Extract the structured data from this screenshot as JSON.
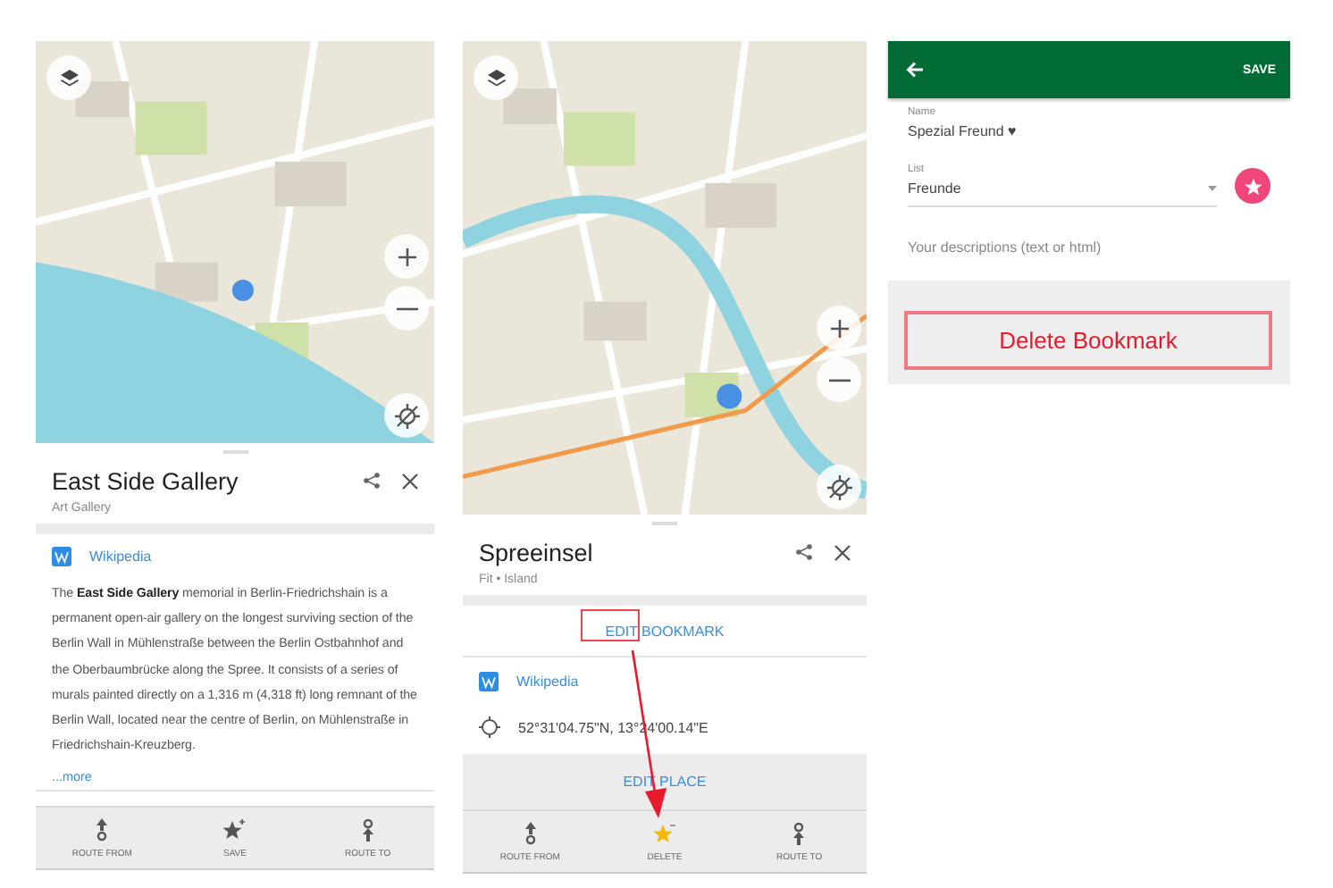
{
  "place_view": {
    "title": "East Side Gallery",
    "subtitle": "Art Gallery",
    "wikipedia_link": "Wikipedia",
    "description": "The **East Side Gallery** memorial in Berlin-Friedrichshain is a permanent open-air gallery on the longest surviving section of the Berlin Wall in Mühlenstraße between the Berlin Ostbahnhof and the Oberbaumbrücke along the Spree. It consists of a series of murals painted directly on a 1,316 m (4,318 ft) long remnant of the Berlin Wall, located near the centre of Berlin, on Mühlenstraße in Friedrichshain-Kreuzberg.",
    "more_link": "...more",
    "toolbar": [
      {
        "kind": "route_from",
        "label": "ROUTE FROM"
      },
      {
        "kind": "save",
        "label": "SAVE"
      },
      {
        "kind": "route_to",
        "label": "ROUTE TO"
      }
    ]
  },
  "bookmark_view": {
    "title": "Spreeinsel",
    "subtitle": "Fit • Island",
    "edit_bookmark": "EDIT BOOKMARK",
    "wikipedia_link": "Wikipedia",
    "coordinates": "52°31'04.75\"N, 13°24'00.14\"E",
    "edit_place": "EDIT PLACE",
    "toolbar": [
      {
        "kind": "route_from",
        "label": "ROUTE FROM"
      },
      {
        "kind": "delete",
        "label": "DELETE"
      },
      {
        "kind": "route_to",
        "label": "ROUTE TO"
      }
    ]
  },
  "bookmark_editor": {
    "save": "SAVE",
    "name_label": "Name",
    "name_value": "Spezial Freund ♥",
    "list_label": "List",
    "list_value": "Freunde",
    "description_placeholder": "Your descriptions (text or html)",
    "delete_button": "Delete Bookmark"
  }
}
